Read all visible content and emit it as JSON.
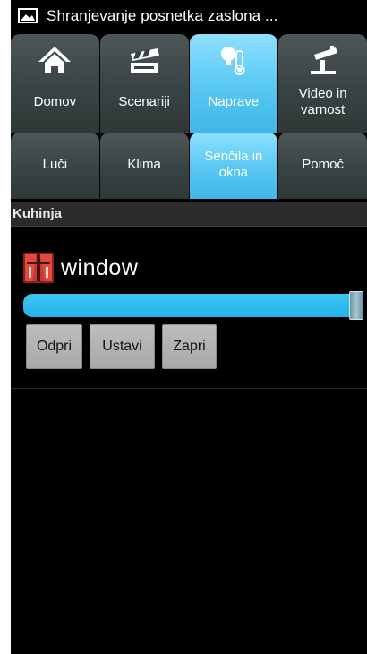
{
  "status_bar": {
    "notification_text": "Shranjevanje posnetka zaslona ...",
    "icon": "screenshot-icon"
  },
  "tabs": {
    "row1": [
      {
        "label": "Domov",
        "icon": "home-icon",
        "active": false
      },
      {
        "label": "Scenariji",
        "icon": "scenario-icon",
        "active": false
      },
      {
        "label": "Naprave",
        "icon": "devices-icon",
        "active": true
      },
      {
        "label": "Video in varnost",
        "icon": "camera-icon",
        "active": false
      }
    ],
    "row2": [
      {
        "label": "Luči",
        "active": false
      },
      {
        "label": "Klima",
        "active": false
      },
      {
        "label": "Senčila in okna",
        "active": true
      },
      {
        "label": "Pomoč",
        "active": false
      }
    ]
  },
  "section": {
    "title": "Kuhinja"
  },
  "device": {
    "name": "window",
    "icon": "blinds-window-icon",
    "position_fraction": 1.0
  },
  "buttons": {
    "open_label": "Odpri",
    "stop_label": "Ustavi",
    "close_label": "Zapri"
  },
  "colors": {
    "active_tab": "#5bc9f3",
    "inactive_tab": "#3a4343",
    "slider": "#24b2ea",
    "background": "#000000"
  }
}
